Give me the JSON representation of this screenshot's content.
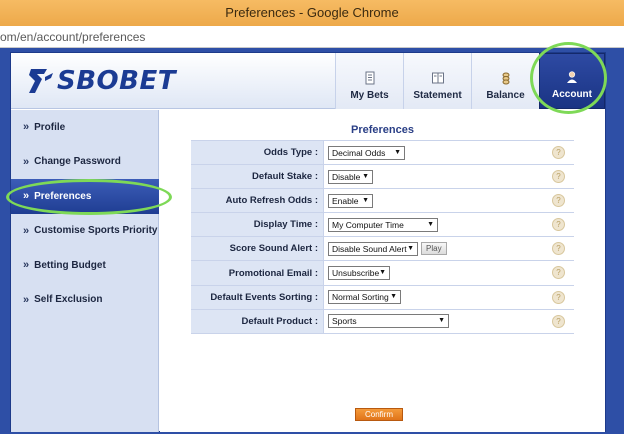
{
  "browser": {
    "title": "Preferences - Google Chrome",
    "url": "om/en/account/preferences"
  },
  "brand": {
    "logo_text": "SBOBET"
  },
  "topnav": [
    {
      "label": "My Bets",
      "icon": "document-icon"
    },
    {
      "label": "Statement",
      "icon": "book-icon"
    },
    {
      "label": "Balance",
      "icon": "coins-icon"
    },
    {
      "label": "Account",
      "icon": "user-icon",
      "active": true
    }
  ],
  "sidebar": [
    {
      "label": "Profile"
    },
    {
      "label": "Change Password"
    },
    {
      "label": "Preferences",
      "active": true
    },
    {
      "label": "Customise Sports Priority"
    },
    {
      "label": "Betting Budget"
    },
    {
      "label": "Self Exclusion"
    }
  ],
  "main": {
    "title": "Preferences",
    "rows": [
      {
        "label": "Odds Type :",
        "value": "Decimal Odds"
      },
      {
        "label": "Default Stake :",
        "value": "Disable"
      },
      {
        "label": "Auto Refresh Odds :",
        "value": "Enable"
      },
      {
        "label": "Display Time :",
        "value": "My Computer Time"
      },
      {
        "label": "Score Sound Alert :",
        "value": "Disable Sound Alert",
        "button": "Play"
      },
      {
        "label": "Promotional Email :",
        "value": "Unsubscribe"
      },
      {
        "label": "Default Events Sorting :",
        "value": "Normal Sorting"
      },
      {
        "label": "Default Product :",
        "value": "Sports"
      }
    ],
    "help_glyph": "?",
    "confirm_label": "Confirm"
  },
  "colors": {
    "brand_blue": "#1b3b93",
    "active_nav": "#1f3d92",
    "confirm_orange": "#e0741a",
    "highlight_green": "#7ed957",
    "chrome_titlebar": "#f0ad4e"
  }
}
